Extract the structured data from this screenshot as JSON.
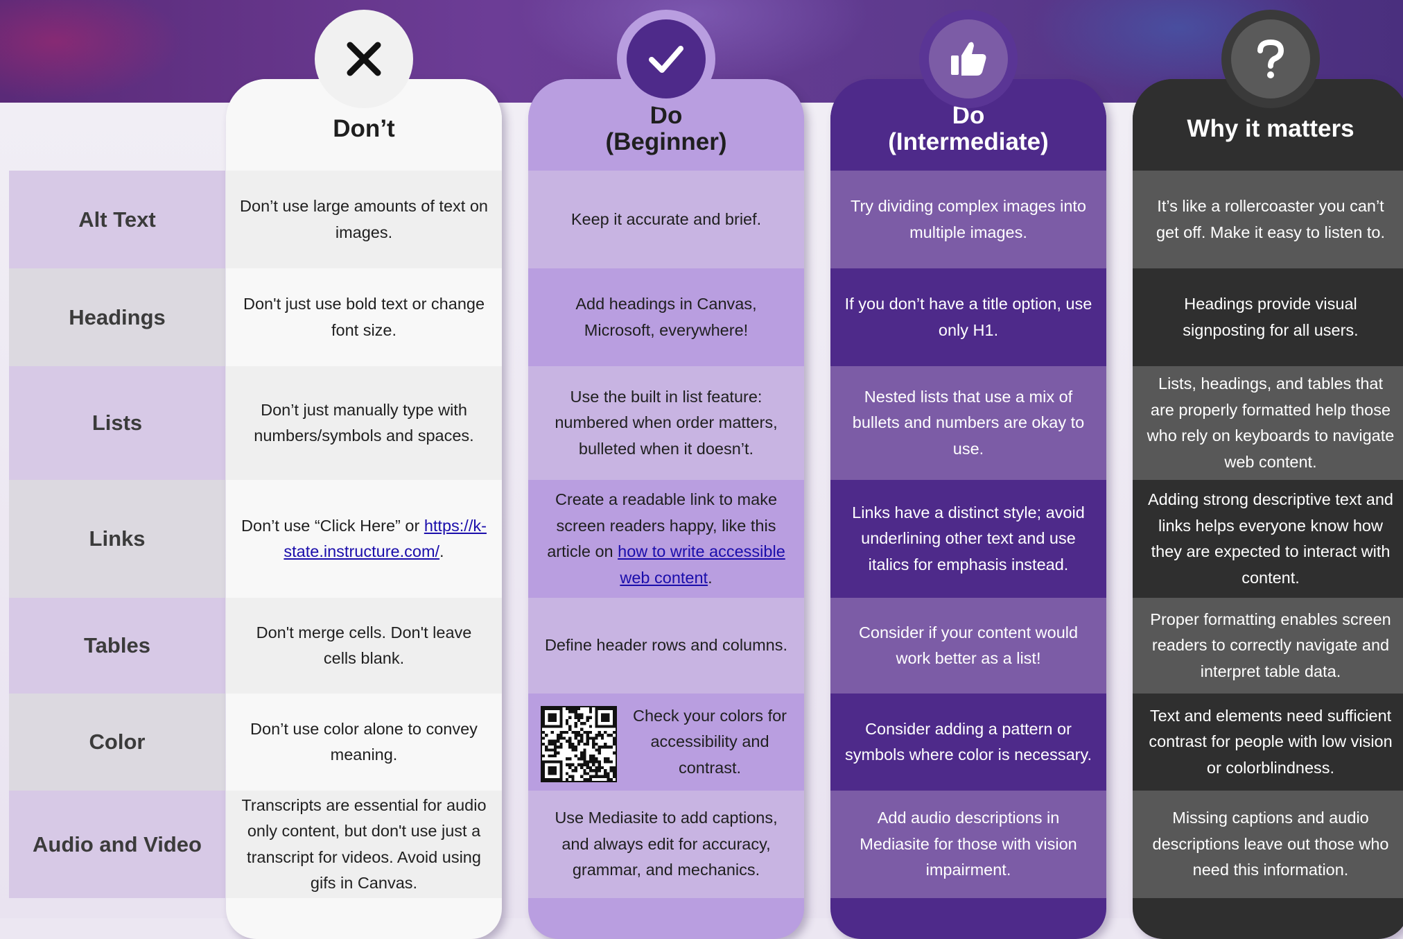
{
  "rows": [
    "Alt Text",
    "Headings",
    "Lists",
    "Links",
    "Tables",
    "Color",
    "Audio and Video"
  ],
  "columns": [
    {
      "id": "dont",
      "heading": "Don’t",
      "icon": "x-icon",
      "cells": [
        "Don’t use large amounts of text on images.",
        "Don't just use bold text or change font size.",
        "Don’t just manually type with numbers/symbols and spaces.",
        {
          "before": "Don’t use “Click Here” or ",
          "link": "https://k-state.instructure.com/",
          "after": "."
        },
        "Don't merge cells. Don't leave cells blank.",
        "Don’t use color alone to convey meaning.",
        "Transcripts are essential for audio only content, but don't use just a transcript for videos. Avoid using gifs in Canvas."
      ]
    },
    {
      "id": "do-beginner",
      "heading": "Do\n(Beginner)",
      "icon": "checkmark-icon",
      "cells": [
        "Keep it accurate and brief.",
        "Add headings in Canvas, Microsoft, everywhere!",
        "Use the built in list feature: numbered when order matters, bulleted when it doesn’t.",
        {
          "before": "Create a readable link to make screen readers happy, like this article on ",
          "link": "how to write accessible web content",
          "after": "."
        },
        "Define header rows and columns.",
        "Check your colors for accessibility and contrast.",
        "Use Mediasite to add captions, and always edit for accuracy, grammar, and mechanics."
      ]
    },
    {
      "id": "do-intermediate",
      "heading": "Do\n(Intermediate)",
      "icon": "thumbs-up-icon",
      "cells": [
        "Try dividing complex images into multiple images.",
        "If you don’t have a title option, use only H1.",
        "Nested lists that use a mix of bullets and numbers are okay to use.",
        "Links have a distinct style; avoid underlining other text and use italics for emphasis instead.",
        "Consider if your content would work better as a list!",
        "Consider adding a pattern or symbols where color is necessary.",
        "Add audio descriptions in Mediasite for those with vision impairment."
      ]
    },
    {
      "id": "why",
      "heading": "Why it matters",
      "icon": "question-mark-icon",
      "cells": [
        "It’s like a rollercoaster you can’t get off. Make it easy to listen to.",
        "Headings provide visual signposting for all users.",
        "Lists, headings, and tables that are properly formatted help those who rely on keyboards to navigate web content.",
        "Adding strong descriptive text and links helps everyone know how they are expected to interact with content.",
        "Proper formatting enables screen readers to correctly navigate and interpret table data.",
        "Text and elements need sufficient contrast for people with low vision or colorblindness.",
        "Missing captions and audio descriptions leave out those who need this information."
      ]
    }
  ],
  "colors": {
    "dont_head": "#f8f8f8",
    "dont_a": "#efefef",
    "dont_b": "#f8f8f8",
    "dont_text": "#1f1f1f",
    "beg_head": "#b99ee0",
    "beg_a": "#c8b4e2",
    "beg_b": "#b99ee0",
    "beg_text": "#1f1f1f",
    "int_head": "#4e2a8a",
    "int_a": "#7c5ca6",
    "int_b": "#4e2a8a",
    "int_text": "#ffffff",
    "why_head": "#2f2f2f",
    "why_a": "#585858",
    "why_b": "#2f2f2f",
    "why_text": "#ffffff",
    "label_a": "#d7c9e6",
    "label_b": "#dcd9e0",
    "link": "#1a0dab"
  }
}
